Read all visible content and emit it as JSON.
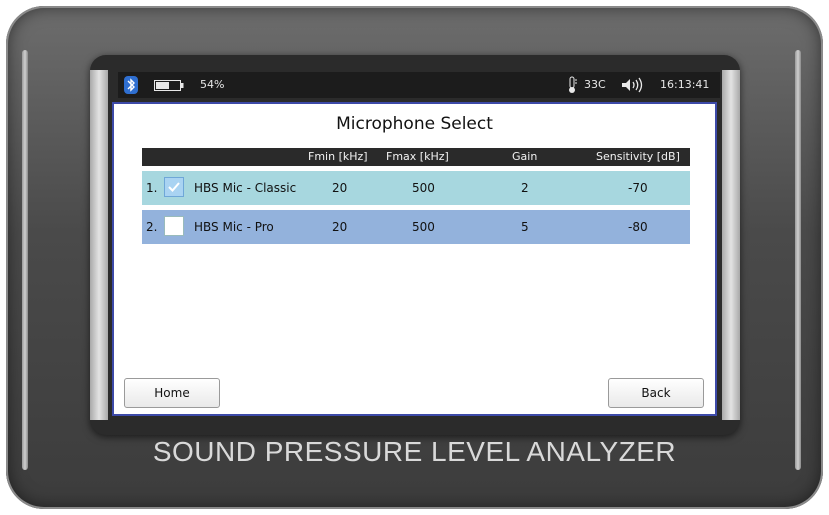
{
  "status": {
    "battery": "54%",
    "temperature": "33C",
    "time": "16:13:41"
  },
  "screen": {
    "title": "Microphone Select",
    "columns": [
      "Fmin [kHz]",
      "Fmax [kHz]",
      "Gain",
      "Sensitivity [dB]"
    ],
    "rows": [
      {
        "index": "1.",
        "checked": true,
        "name": "HBS Mic - Classic",
        "fmin": "20",
        "fmax": "500",
        "gain": "2",
        "sensitivity": "-70"
      },
      {
        "index": "2.",
        "checked": false,
        "name": "HBS Mic - Pro",
        "fmin": "20",
        "fmax": "500",
        "gain": "5",
        "sensitivity": "-80"
      }
    ],
    "home_label": "Home",
    "back_label": "Back"
  },
  "device": {
    "label": "SOUND PRESSURE LEVEL ANALYZER"
  },
  "colors": {
    "row1": "#a7d7df",
    "row2": "#93b2dc",
    "header": "#2a2a2a",
    "screen_border": "#3d4aa8"
  },
  "icons": [
    "bluetooth-icon",
    "battery-icon",
    "thermometer-icon",
    "speaker-icon",
    "checkmark-icon"
  ]
}
